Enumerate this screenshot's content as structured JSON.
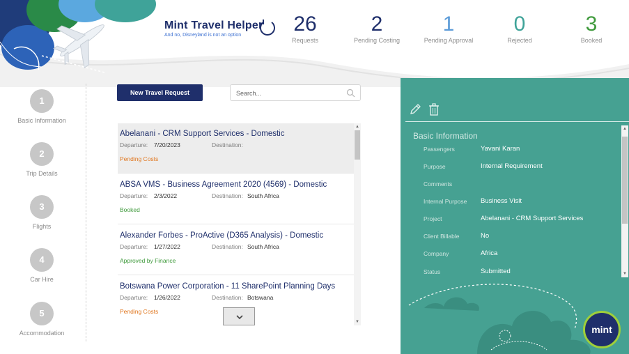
{
  "app": {
    "title": "Mint Travel Helper",
    "subtitle": "And no, Disneyland is not an option"
  },
  "colors": {
    "navy": "#1f2f6b",
    "blue": "#4f8fd6",
    "teal": "#3fa399",
    "green": "#3f9a3c",
    "orange": "#e0761e",
    "panel": "#46a192"
  },
  "stats": [
    {
      "value": "26",
      "label": "Requests",
      "color": "#1f2f6b"
    },
    {
      "value": "2",
      "label": "Pending Costing",
      "color": "#1f2f6b"
    },
    {
      "value": "1",
      "label": "Pending Approval",
      "color": "#5b9bd8"
    },
    {
      "value": "0",
      "label": "Rejected",
      "color": "#3fa399"
    },
    {
      "value": "3",
      "label": "Booked",
      "color": "#3f9a3c"
    }
  ],
  "steps": [
    {
      "num": "1",
      "label": "Basic Information"
    },
    {
      "num": "2",
      "label": "Trip Details"
    },
    {
      "num": "3",
      "label": "Flights"
    },
    {
      "num": "4",
      "label": "Car Hire"
    },
    {
      "num": "5",
      "label": "Accommodation"
    }
  ],
  "actions": {
    "new_request": "New Travel Request",
    "search_placeholder": "Search..."
  },
  "list_labels": {
    "departure": "Departure:",
    "destination": "Destination:"
  },
  "requests": [
    {
      "title": "Abelanani - CRM Support Services - Domestic",
      "departure": "7/20/2023",
      "destination": "",
      "status": "Pending Costs",
      "status_color": "#e0761e"
    },
    {
      "title": "ABSA VMS - Business Agreement 2020 (4569) - Domestic",
      "departure": "2/3/2022",
      "destination": "South Africa",
      "status": "Booked",
      "status_color": "#3f9a3c"
    },
    {
      "title": "Alexander Forbes - ProActive (D365 Analysis) - Domestic",
      "departure": "1/27/2022",
      "destination": "South Africa",
      "status": "Approved by Finance",
      "status_color": "#3f9a3c"
    },
    {
      "title": "Botswana Power Corporation - 11 SharePoint Planning Days",
      "departure": "1/26/2022",
      "destination": "Botswana",
      "status": "Pending Costs",
      "status_color": "#e0761e"
    }
  ],
  "details": {
    "section_title": "Basic Information",
    "fields": [
      {
        "label": "Passengers",
        "value": "Yavani Karan"
      },
      {
        "label": "Purpose",
        "value": "Internal Requirement"
      },
      {
        "label": "Comments",
        "value": ""
      },
      {
        "label": "Internal Purpose",
        "value": "Business Visit"
      },
      {
        "label": "Project",
        "value": "Abelanani - CRM Support Services"
      },
      {
        "label": "Client Billable",
        "value": "No"
      },
      {
        "label": "Company",
        "value": "Africa"
      },
      {
        "label": "Status",
        "value": "Submitted"
      }
    ],
    "logo_text": "mint"
  }
}
